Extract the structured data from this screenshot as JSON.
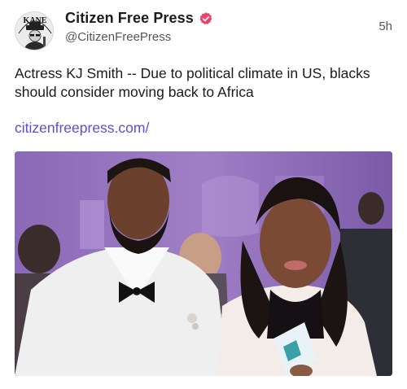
{
  "post": {
    "author_name": "Citizen Free Press",
    "author_handle": "@CitizenFreePress",
    "timestamp": "5h",
    "text": "Actress KJ Smith -- Due to political climate in US, blacks should consider moving back to Africa",
    "link": "citizenfreepress.com/",
    "avatar_text": "KANE",
    "verified_icon": "verified-badge-icon"
  },
  "colors": {
    "verified": "#e8436a",
    "link": "#5a4fd8",
    "media_background": "#8f6fb7"
  }
}
